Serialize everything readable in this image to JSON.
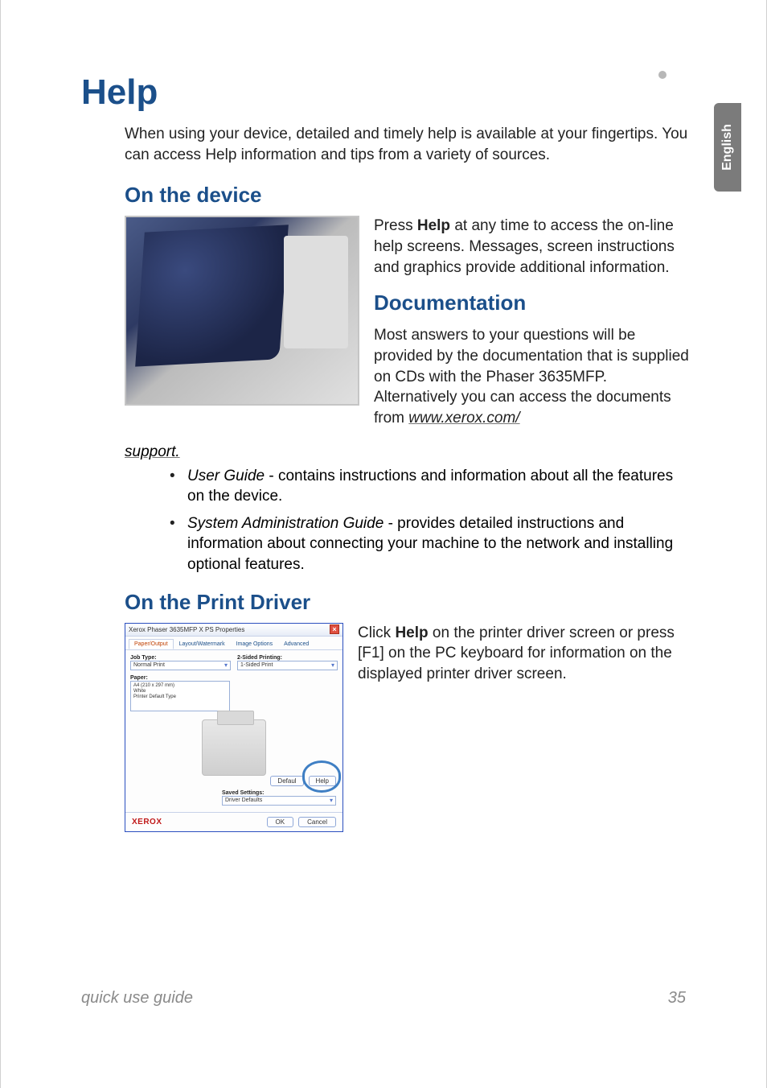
{
  "language_tab": "English",
  "title": "Help",
  "intro": "When using your device, detailed and timely help is available at your fingertips. You can access Help information and tips from a variety of sources.",
  "section_device": "On the device",
  "device_text_pre": "Press ",
  "device_text_bold": "Help",
  "device_text_post": " at any time to access the on-line help screens. Messages, screen instructions and graphics provide additional information.",
  "section_documentation": "Documentation",
  "documentation_text": "Most answers to your questions will be provided by the documentation that is supplied on CDs with the Phaser 3635MFP. Alternatively you can access the documents from ",
  "documentation_link": "www.xerox.com/support",
  "documentation_link_tail": "support.",
  "documentation_link_head": "www.xerox.com/",
  "bullets": [
    {
      "em": "User Guide",
      "rest": " - contains instructions and information about all the features on the device."
    },
    {
      "em": "System Administration Guide",
      "rest": " - provides detailed instructions and information about connecting your machine to the network and installing optional features."
    }
  ],
  "section_driver": "On the Print Driver",
  "driver_text_pre": "Click ",
  "driver_text_bold": "Help",
  "driver_text_post": " on the printer driver screen or press [F1] on the PC keyboard for information on the displayed printer driver screen.",
  "driver_dialog": {
    "title": "Xerox Phaser 3635MFP X PS Properties",
    "tabs": [
      "Paper/Output",
      "Layout/Watermark",
      "Image Options",
      "Advanced"
    ],
    "job_type_label": "Job Type:",
    "job_type_value": "Normal Print",
    "two_sided_label": "2-Sided Printing:",
    "two_sided_value": "1-Sided Print",
    "paper_label": "Paper:",
    "paper_lines": "A4 (210 x 297 mm)\nWhite\nPrinter Default Type",
    "defaults_btn": "Defaul",
    "help_btn": "Help",
    "saved_label": "Saved Settings:",
    "saved_value": "Driver Defaults",
    "brand": "XEROX",
    "ok_btn": "OK",
    "cancel_btn": "Cancel"
  },
  "footer_left": "quick use guide",
  "footer_right": "35"
}
